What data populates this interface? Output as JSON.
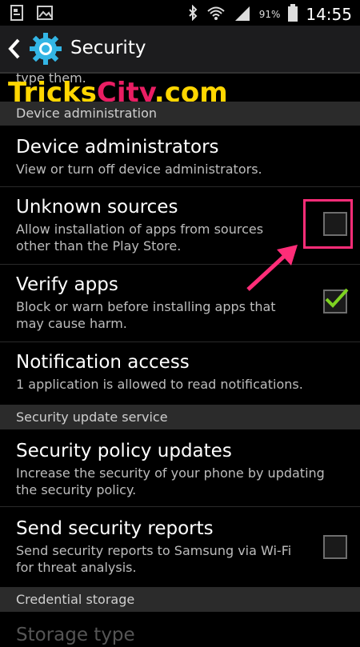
{
  "status_bar": {
    "battery": "91%",
    "time": "14:55"
  },
  "action_bar": {
    "title": "Security"
  },
  "partial_top_text": "type them.",
  "watermark": {
    "part1": "Tricks",
    "part2": "City",
    "part3": ".com"
  },
  "sections": {
    "device_administration": "Device administration",
    "security_update_service": "Security update service",
    "credential_storage": "Credential storage"
  },
  "items": {
    "device_administrators": {
      "title": "Device administrators",
      "summary": "View or turn off device administrators."
    },
    "unknown_sources": {
      "title": "Unknown sources",
      "summary": "Allow installation of apps from sources other than the Play Store.",
      "checked": false
    },
    "verify_apps": {
      "title": "Verify apps",
      "summary": "Block or warn before installing apps that may cause harm.",
      "checked": true
    },
    "notification_access": {
      "title": "Notification access",
      "summary": "1 application is allowed to read notifications."
    },
    "security_policy_updates": {
      "title": "Security policy updates",
      "summary": "Increase the security of your phone by updating the security policy."
    },
    "send_security_reports": {
      "title": "Send security reports",
      "summary": "Send security reports to Samsung via Wi-Fi for threat analysis.",
      "checked": false
    },
    "storage_type": {
      "title": "Storage type"
    }
  },
  "colors": {
    "accent_blue": "#33b5e5",
    "check_green": "#7ed321",
    "highlight_pink": "#ff2d78"
  }
}
